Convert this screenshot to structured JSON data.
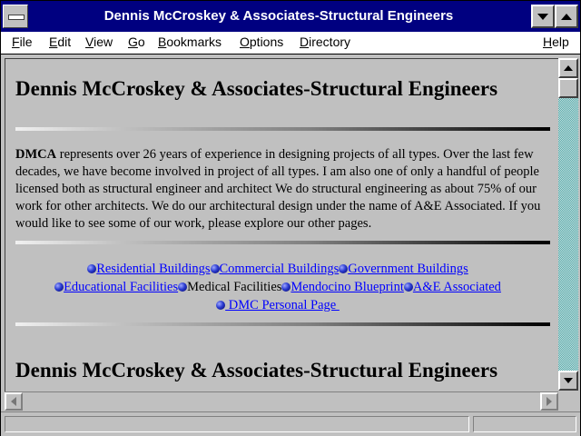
{
  "window": {
    "title": "Dennis McCroskey & Associates-Structural Engineers"
  },
  "menu": {
    "file": "File",
    "edit": "Edit",
    "view": "View",
    "go": "Go",
    "bookmarks": "Bookmarks",
    "options": "Options",
    "directory": "Directory",
    "help": "Help"
  },
  "page": {
    "heading": "Dennis McCroskey & Associates-Structural Engineers",
    "intro_bold": "DMCA",
    "intro_text": " represents over 26 years of experience in designing projects of all types. Over the last few decades, we have become involved in project of all types. I am also one of only a handful of people licensed both as structural engineer and architect We do structural engineering as about 75% of our work for other architects. We do our architectural design under the name of A&E Associated. If you would like to see some of our work, please explore our other pages.",
    "links": {
      "residential": "Residential Buildings",
      "commercial": "Commercial Buildings",
      "government": "Government Buildings",
      "educational": "Educational Facilities",
      "medical": "Medical Facilities",
      "mendocino": "Mendocino Blueprint",
      "ae": "A&E Associated",
      "personal": " DMC Personal Page "
    },
    "heading2": "Dennis McCroskey & Associates-Structural Engineers"
  },
  "status": {
    "text": ""
  }
}
